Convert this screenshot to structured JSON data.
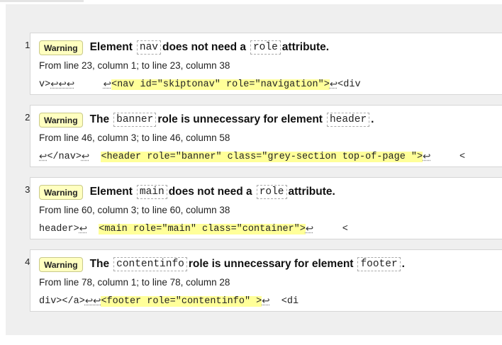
{
  "messages": [
    {
      "number": "1.",
      "type": "Warning",
      "title_parts": [
        "Element",
        "nav",
        "does not need a",
        "role",
        "attribute."
      ],
      "location": "From line 23, column 1; to line 23, column 38",
      "extract_before": "v>",
      "extract_before_rets": "↩↩↩",
      "extract_gap": "     ",
      "extract_ret_lead": "↩",
      "extract_highlight": "<nav id=\"skiptonav\" role=\"navigation\">",
      "extract_ret_trail": "↩",
      "extract_after": "<div"
    },
    {
      "number": "2.",
      "type": "Warning",
      "title_parts": [
        "The",
        "banner",
        "role is unnecessary for element",
        "header",
        "."
      ],
      "location": "From line 46, column 3; to line 46, column 58",
      "extract_ret_lead": "↩",
      "extract_before": "</nav>",
      "extract_before_rets": "↩",
      "extract_gap": "  ",
      "extract_highlight": "<header role=\"banner\" class=\"grey-section top-of-page \">",
      "extract_ret_trail": "↩",
      "extract_after": "     <"
    },
    {
      "number": "3.",
      "type": "Warning",
      "title_parts": [
        "Element",
        "main",
        "does not need a",
        "role",
        "attribute."
      ],
      "location": "From line 60, column 3; to line 60, column 38",
      "extract_before": "header>",
      "extract_before_rets": "↩",
      "extract_gap": "  ",
      "extract_highlight": "<main role=\"main\" class=\"container\">",
      "extract_ret_trail": "↩",
      "extract_after": "     <"
    },
    {
      "number": "4.",
      "type": "Warning",
      "title_parts": [
        "The",
        "contentinfo",
        "role is unnecessary for element",
        "footer",
        "."
      ],
      "location": "From line 78, column 1; to line 78, column 28",
      "extract_before": "div></a>",
      "extract_before_rets": "↩↩",
      "extract_highlight": "<footer role=\"contentinfo\" >",
      "extract_ret_trail": "↩",
      "extract_after": "  <di"
    }
  ]
}
